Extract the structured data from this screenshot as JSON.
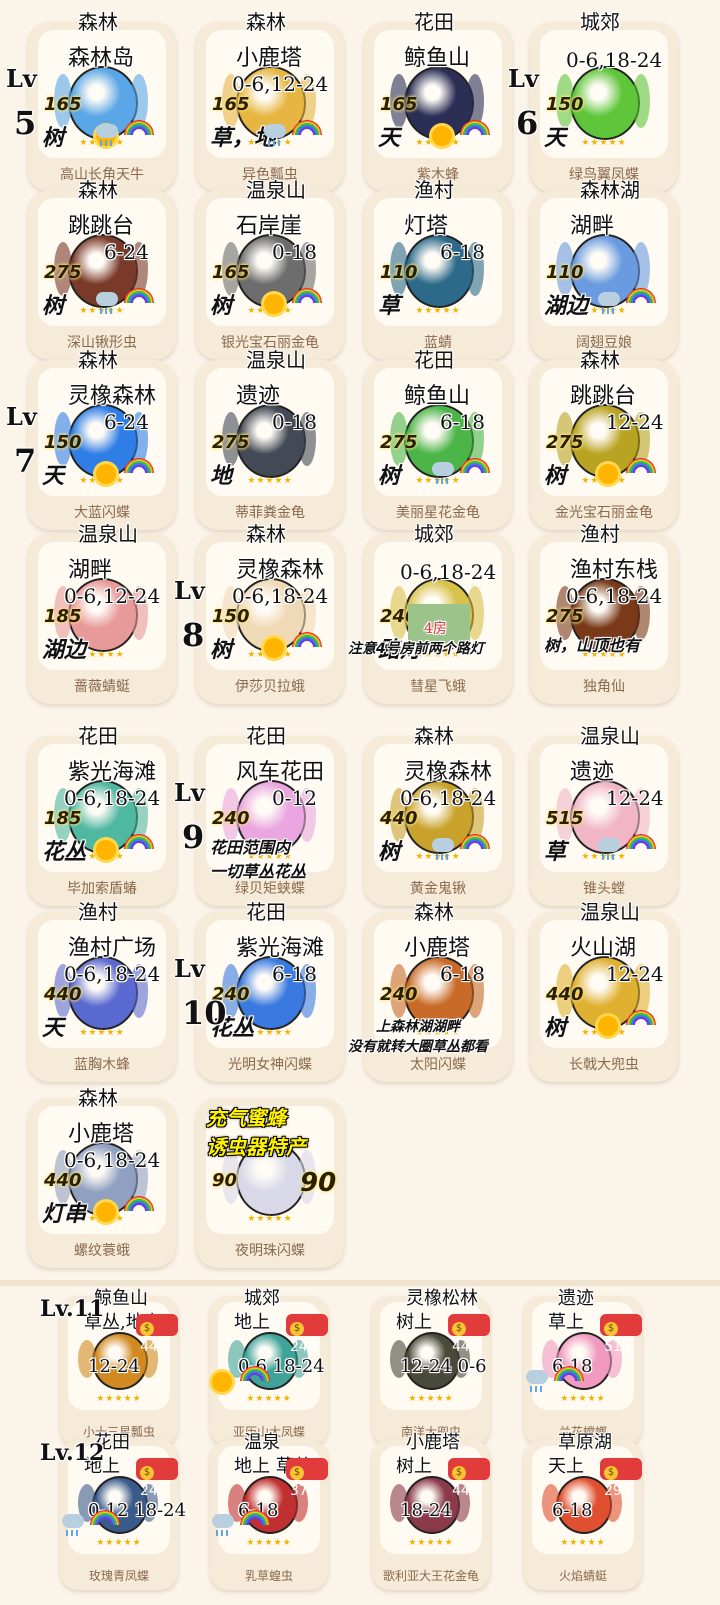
{
  "cards": [
    {
      "region": "森林",
      "spot": "森林岛",
      "price": "165",
      "time": "",
      "place": "树",
      "name": "高山长角天牛",
      "weather": "both",
      "color": "#5aa6e6",
      "level": "Lv",
      "levelNum": "5"
    },
    {
      "region": "森林",
      "spot": "小鹿塔",
      "price": "165",
      "time": "0-6,12-24",
      "place": "草，地",
      "name": "异色瓢虫",
      "weather": "rain",
      "color": "#e7b642"
    },
    {
      "region": "花田",
      "spot": "鲸鱼山",
      "price": "165",
      "time": "",
      "place": "天",
      "name": "紫木蜂",
      "weather": "sun",
      "color": "#2b2f55"
    },
    {
      "region": "城郊",
      "spot": "",
      "price": "150",
      "time": "0-6,18-24",
      "place": "天",
      "name": "绿鸟翼凤蝶",
      "weather": "none",
      "color": "#5fc63a",
      "level": "Lv",
      "levelNum": "6"
    },
    {
      "region": "森林",
      "spot": "跳跳台",
      "price": "275",
      "time": "6-24",
      "place": "树",
      "name": "深山锹形虫",
      "weather": "rain",
      "color": "#7a3a2a"
    },
    {
      "region": "温泉山",
      "spot": "石岸崖",
      "price": "165",
      "time": "0-18",
      "place": "树",
      "name": "银光宝石丽金龟",
      "weather": "sun",
      "color": "#6d6d6d"
    },
    {
      "region": "渔村",
      "spot": "灯塔",
      "price": "110",
      "time": "6-18",
      "place": "草",
      "name": "蓝蜻",
      "weather": "none",
      "color": "#2d6a8a"
    },
    {
      "region": "森林湖",
      "spot": "湖畔",
      "price": "110",
      "time": "",
      "place": "湖边",
      "name": "阔翅豆娘",
      "weather": "rain",
      "color": "#6a9be0"
    },
    {
      "region": "森林",
      "spot": "灵橡森林",
      "price": "150",
      "time": "6-24",
      "place": "天",
      "name": "大蓝闪蝶",
      "weather": "sun",
      "color": "#2f7ee6",
      "level": "Lv",
      "levelNum": "7"
    },
    {
      "region": "温泉山",
      "spot": "遗迹",
      "price": "275",
      "time": "0-18",
      "place": "地",
      "name": "蒂菲粪金龟",
      "weather": "none",
      "color": "#444a55"
    },
    {
      "region": "花田",
      "spot": "鲸鱼山",
      "price": "275",
      "time": "6-18",
      "place": "树",
      "name": "美丽星花金龟",
      "weather": "rain",
      "color": "#4bb548"
    },
    {
      "region": "森林",
      "spot": "跳跳台",
      "price": "275",
      "time": "12-24",
      "place": "树",
      "name": "金光宝石丽金龟",
      "weather": "sun",
      "color": "#b9a322"
    },
    {
      "region": "温泉山",
      "spot": "湖畔",
      "price": "185",
      "time": "0-6,12-24",
      "place": "湖边",
      "name": "蔷薇蜻蜓",
      "weather": "none",
      "color": "#e89a9a"
    },
    {
      "region": "森林",
      "spot": "灵橡森林",
      "price": "150",
      "time": "0-6,18-24",
      "place": "树",
      "name": "伊莎贝拉蛾",
      "weather": "sun",
      "color": "#f0d9b6",
      "level": "Lv",
      "levelNum": "8"
    },
    {
      "region": "城郊",
      "spot": "",
      "price": "240",
      "time": "0-6,18-24",
      "place": "路灯",
      "name": "彗星飞蛾",
      "weather": "none",
      "color": "#d8c24a",
      "note": "注意4号房前两个路灯",
      "lamp": "4房"
    },
    {
      "region": "渔村",
      "spot": "渔村东栈",
      "price": "275",
      "time": "0-6,18-24",
      "place": "树，山顶也有",
      "name": "独角仙",
      "weather": "none",
      "color": "#7a3a1a"
    },
    {
      "region": "花田",
      "spot": "紫光海滩",
      "price": "185",
      "time": "0-6,18-24",
      "place": "花丛",
      "name": "毕加索盾蝽",
      "weather": "sun",
      "color": "#4fb8a0"
    },
    {
      "region": "花田",
      "spot": "风车花田",
      "price": "240",
      "time": "0-12",
      "place": "花田范围内\n一切草丛花丛",
      "name": "绿贝矩蛱蝶",
      "weather": "none",
      "color": "#e9a6e0",
      "level": "Lv",
      "levelNum": "9"
    },
    {
      "region": "森林",
      "spot": "灵橡森林",
      "price": "440",
      "time": "0-6,18-24",
      "place": "树",
      "name": "黄金鬼锹",
      "weather": "rain",
      "color": "#c9a22c"
    },
    {
      "region": "温泉山",
      "spot": "遗迹",
      "price": "515",
      "time": "12-24",
      "place": "草",
      "name": "锥头螳",
      "weather": "rain",
      "color": "#f0b6c6"
    },
    {
      "region": "渔村",
      "spot": "渔村广场",
      "price": "440",
      "time": "0-6,18-24",
      "place": "天",
      "name": "蓝胸木蜂",
      "weather": "none",
      "color": "#5b6ad0"
    },
    {
      "region": "花田",
      "spot": "紫光海滩",
      "price": "240",
      "time": "6-18",
      "place": "花丛",
      "name": "光明女神闪蝶",
      "weather": "none",
      "color": "#3a7ae0",
      "level": "Lv",
      "levelNum": "10"
    },
    {
      "region": "森林",
      "spot": "小鹿塔",
      "price": "240",
      "time": "6-18",
      "place": "",
      "name": "太阳闪蝶",
      "weather": "none",
      "color": "#c86a28",
      "note": "上森林湖湖畔\n没有就转大圈草丛都看"
    },
    {
      "region": "温泉山",
      "spot": "火山湖",
      "price": "440",
      "time": "12-24",
      "place": "树",
      "name": "长戟大兜虫",
      "weather": "sun",
      "color": "#e0b030"
    },
    {
      "region": "森林",
      "spot": "小鹿塔",
      "price": "440",
      "time": "0-6,18-24",
      "place": "灯串",
      "name": "螺纹蓑蛾",
      "weather": "sun",
      "color": "#8fa0c0"
    },
    {
      "region": "",
      "spot": "",
      "price": "90",
      "time": "",
      "place": "",
      "name": "夜明珠闪蝶",
      "weather": "none",
      "color": "#d8d8e8",
      "special": "充气蜜蜂\n诱虫器特产"
    }
  ],
  "small": [
    {
      "spot": "鲸鱼山",
      "place": "草丛,地上",
      "price": "440",
      "time": "12-24",
      "name": "小十三星瓢虫",
      "weather": "none",
      "color": "#d08a20",
      "level": "Lv.11"
    },
    {
      "spot": "城郊",
      "place": "地上",
      "price": "240",
      "time": "0-6 18-24",
      "name": "亚历山大凤蝶",
      "weather": "sun",
      "color": "#3fa39a"
    },
    {
      "spot": "灵橡松林",
      "place": "树上",
      "price": "440",
      "time": "12-24 0-6",
      "name": "南洋大兜虫",
      "weather": "none",
      "color": "#4a4a3a"
    },
    {
      "spot": "遗迹",
      "place": "草上",
      "price": "515",
      "time": "6-18",
      "name": "兰花螳螂",
      "weather": "rain",
      "color": "#f09ac0"
    },
    {
      "spot": "花田",
      "place": "地上",
      "price": "240",
      "time": "0-12 18-24",
      "name": "玫瑰青凤蝶",
      "weather": "rain",
      "color": "#3a5a8a",
      "level": "Lv.12"
    },
    {
      "spot": "温泉",
      "place": "地上 草丛",
      "price": "370",
      "time": "6-18",
      "name": "乳草蝗虫",
      "weather": "rain",
      "color": "#c03030"
    },
    {
      "spot": "小鹿塔",
      "place": "树上",
      "price": "440",
      "time": "18-24",
      "name": "歌利亚大王花金龟",
      "weather": "none",
      "color": "#8a3a4a"
    },
    {
      "spot": "草原湖",
      "place": "天上",
      "price": "295",
      "time": "6-18",
      "name": "火焰蜻蜓",
      "weather": "none",
      "color": "#e05030"
    }
  ],
  "stars": "★★★★★"
}
